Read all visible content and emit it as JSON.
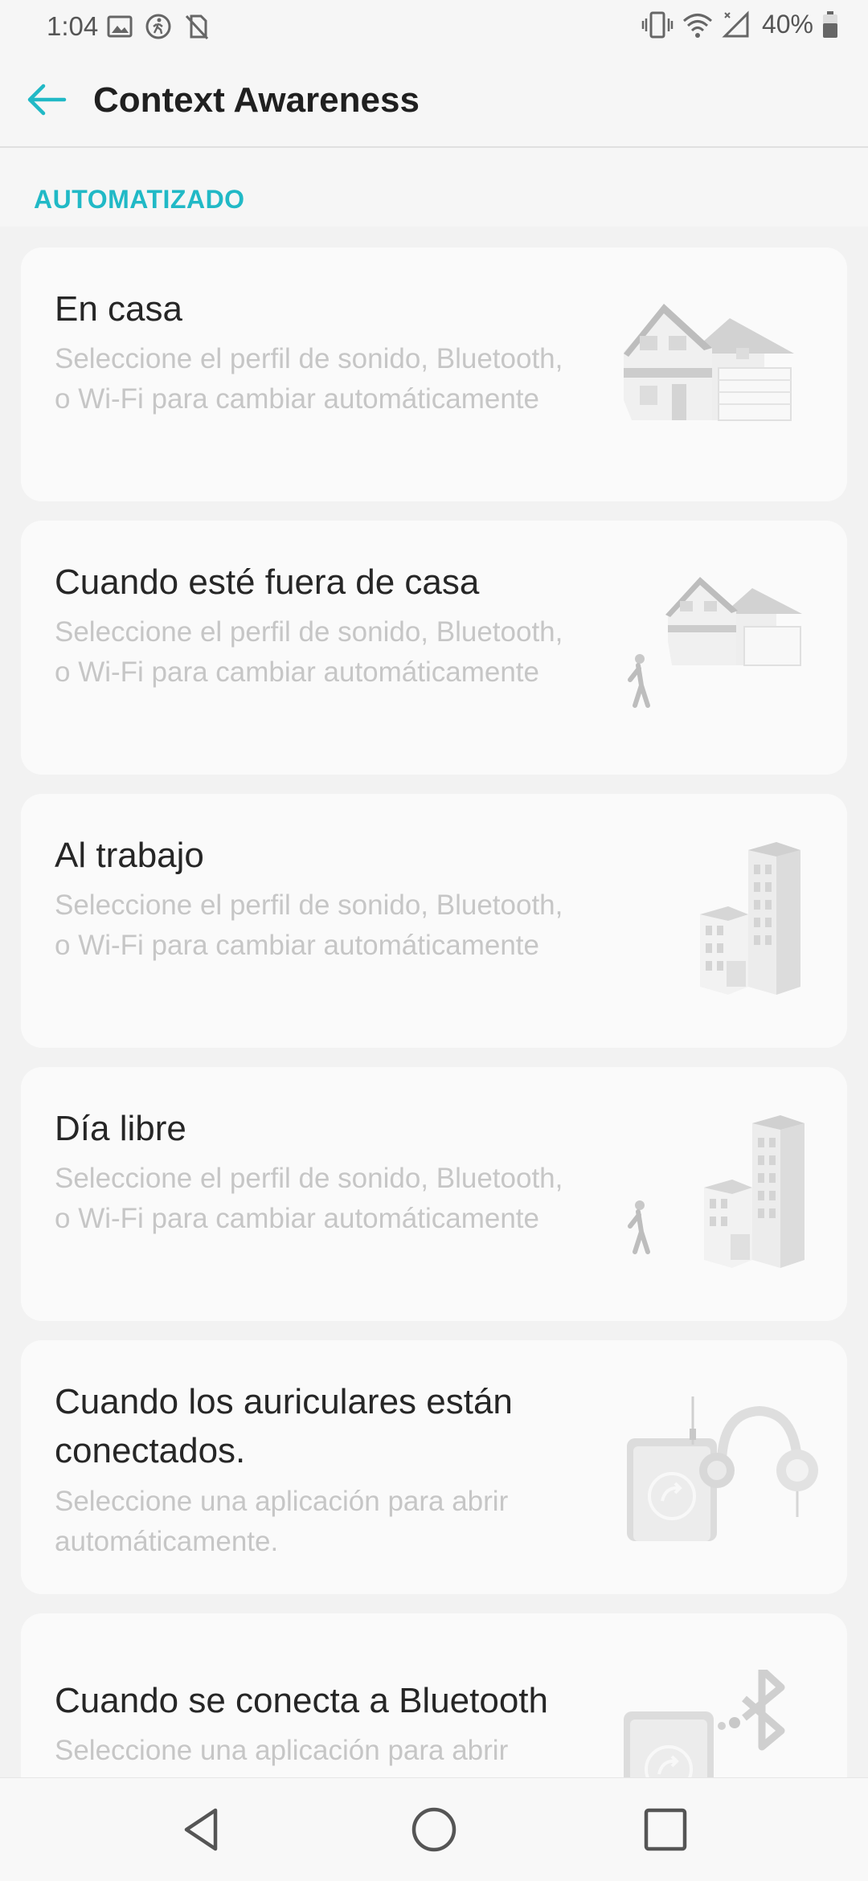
{
  "status_bar": {
    "time": "1:04",
    "battery": "40%"
  },
  "app_bar": {
    "title": "Context Awareness"
  },
  "section": {
    "title": "AUTOMATIZADO"
  },
  "accent_color": "#21b9c6",
  "cards": [
    {
      "title": "En casa",
      "description": "Seleccione el perfil de sonido, Bluetooth, o Wi-Fi para cambiar automáticamente",
      "icon": "house-icon"
    },
    {
      "title": "Cuando esté fuera de casa",
      "description": "Seleccione el perfil de sonido, Bluetooth, o Wi-Fi para cambiar automáticamente",
      "icon": "leaving-home-icon"
    },
    {
      "title": "Al trabajo",
      "description": "Seleccione el perfil de sonido, Bluetooth, o Wi-Fi para cambiar automáticamente",
      "icon": "office-building-icon"
    },
    {
      "title": "Día libre",
      "description": "Seleccione el perfil de sonido, Bluetooth, o Wi-Fi para cambiar automáticamente",
      "icon": "day-off-icon"
    },
    {
      "title": "Cuando los auriculares están conectados.",
      "description": "Seleccione una aplicación para abrir automáticamente.",
      "icon": "headphones-phone-icon"
    },
    {
      "title": "Cuando se conecta a Bluetooth",
      "description": "Seleccione una aplicación para abrir automáticamente.",
      "icon": "bluetooth-phone-icon"
    }
  ]
}
